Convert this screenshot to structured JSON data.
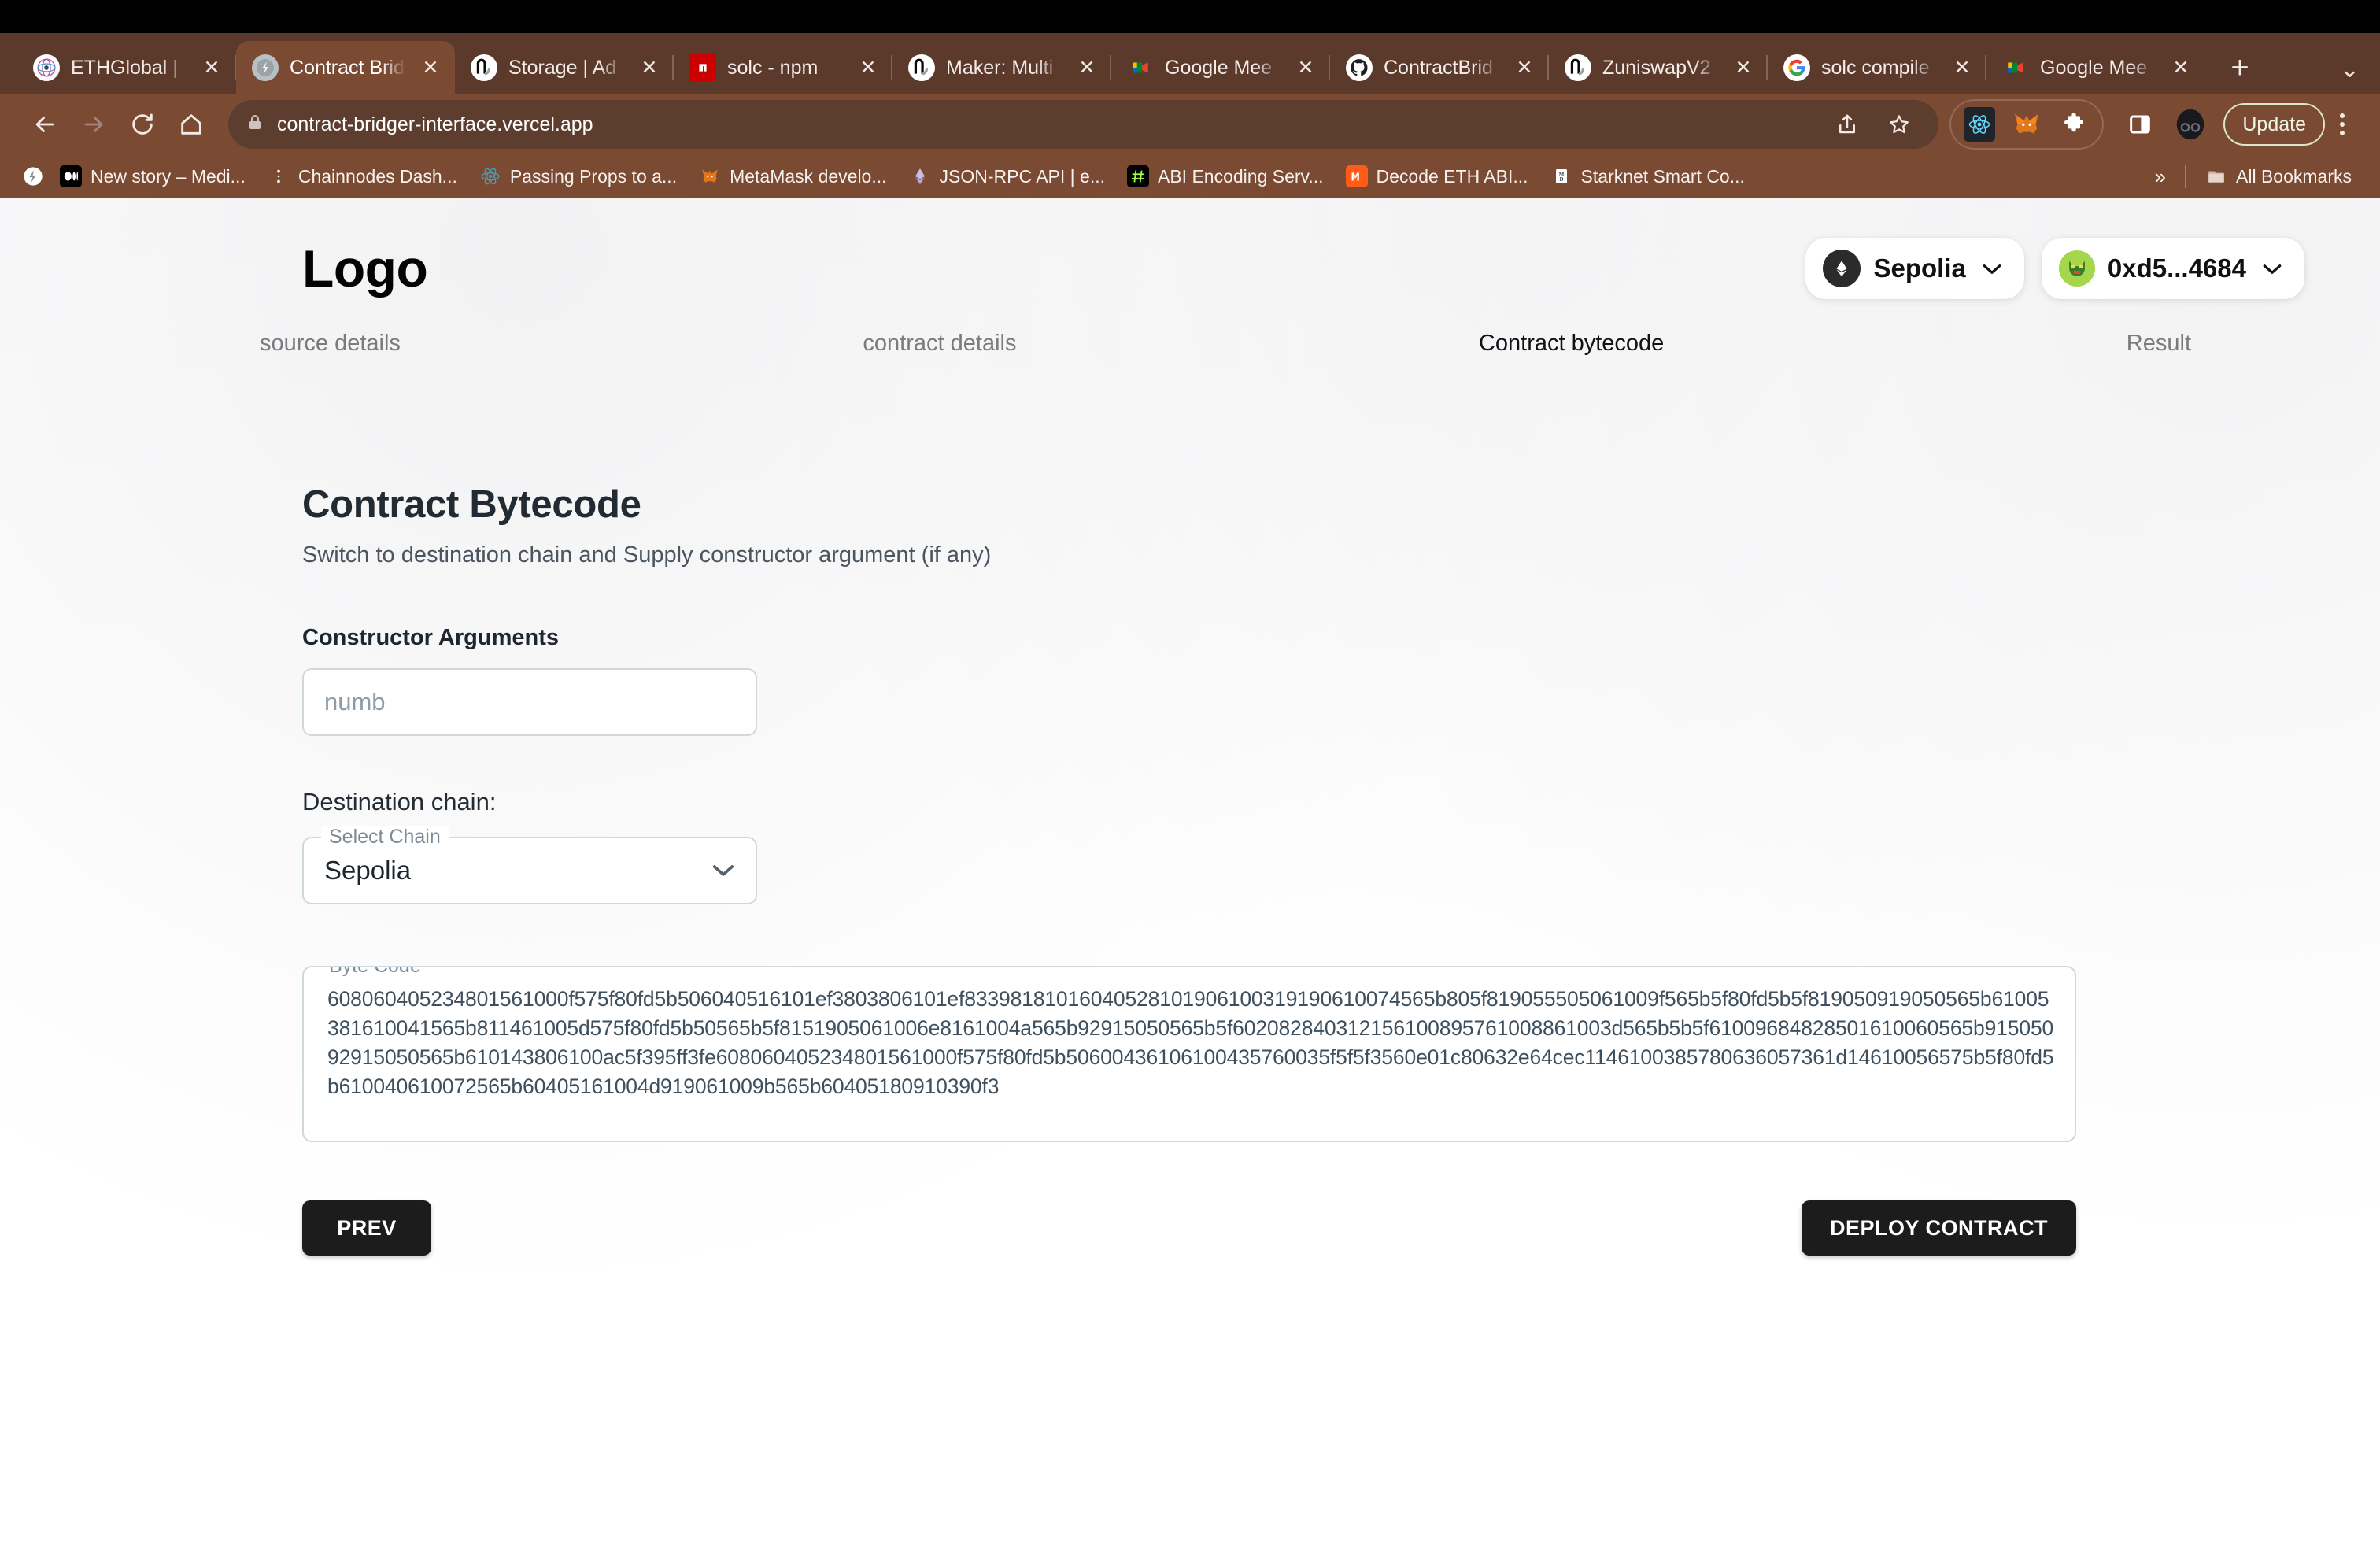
{
  "browser": {
    "tabs": [
      {
        "title": "ETHGlobal | ",
        "icon": "ethglobal-icon",
        "active": false
      },
      {
        "title": "Contract Brid",
        "icon": "contract-bridger-icon",
        "active": true
      },
      {
        "title": "Storage | Ad",
        "icon": "remix-icon",
        "active": false
      },
      {
        "title": "solc - npm",
        "icon": "npm-icon",
        "active": false
      },
      {
        "title": "Maker: Multi",
        "icon": "remix-icon",
        "active": false
      },
      {
        "title": "Google Mee",
        "icon": "google-meet-icon",
        "active": false
      },
      {
        "title": "ContractBrid",
        "icon": "github-icon",
        "active": false
      },
      {
        "title": "ZuniswapV2",
        "icon": "remix-icon",
        "active": false
      },
      {
        "title": "solc compile",
        "icon": "google-icon",
        "active": false
      },
      {
        "title": "Google Mee",
        "icon": "google-meet-icon",
        "active": false
      }
    ],
    "new_tab_label": "+",
    "tab_overflow_label": "⌄",
    "nav": {
      "back_label": "←",
      "forward_label": "→",
      "reload_label": "↻",
      "home_label": "⌂"
    },
    "omnibox": {
      "url": "contract-bridger-interface.vercel.app",
      "lock_icon": "lock-icon",
      "share_icon": "share-icon",
      "bookmark_icon": "star-icon"
    },
    "extensions": [
      {
        "name": "react-devtools-icon"
      },
      {
        "name": "metamask-icon"
      },
      {
        "name": "puzzle-icon"
      }
    ],
    "side_panel_icon": "side-panel-icon",
    "profile_icon": "profile-avatar-icon",
    "update_label": "Update",
    "menu_icon": "kebab-menu-icon",
    "bookmarks": [
      {
        "label": "New story – Medi...",
        "icon": "medium-icon"
      },
      {
        "label": "Chainnodes Dash...",
        "icon": "chainnodes-icon"
      },
      {
        "label": "Passing Props to a...",
        "icon": "react-icon"
      },
      {
        "label": "MetaMask develo...",
        "icon": "metamask-icon"
      },
      {
        "label": "JSON-RPC API | e...",
        "icon": "ethereum-icon"
      },
      {
        "label": "ABI Encoding Serv...",
        "icon": "hash-icon"
      },
      {
        "label": "Decode ETH ABI...",
        "icon": "decode-icon"
      },
      {
        "label": "Starknet Smart Co...",
        "icon": "markdown-icon"
      }
    ],
    "bookmarks_overflow_label": "»",
    "all_bookmarks_label": "All Bookmarks",
    "all_bookmarks_icon": "folder-icon"
  },
  "app": {
    "logo": "Logo",
    "network": {
      "label": "Sepolia",
      "icon": "ethereum-diamond-icon",
      "chevron": "⌄"
    },
    "wallet": {
      "address": "0xd5...4684",
      "avatar_icon": "wallet-avatar-icon",
      "chevron": "⌄"
    },
    "steps": [
      {
        "label": "source details",
        "current": false
      },
      {
        "label": "contract details",
        "current": false
      },
      {
        "label": "Contract bytecode",
        "current": true
      },
      {
        "label": "Result",
        "current": false
      }
    ],
    "heading": "Contract Bytecode",
    "subheading": "Switch to destination chain and Supply constructor argument (if any)",
    "constructor": {
      "label": "Constructor Arguments",
      "placeholder": "numb",
      "value": ""
    },
    "destination": {
      "label": "Destination chain:",
      "legend": "Select Chain",
      "value": "Sepolia",
      "chevron": "⌄",
      "options": [
        "Sepolia"
      ]
    },
    "bytecode": {
      "legend": "Byte Code",
      "value": "60806040523480156100​0f575f80fd5b506040516101ef3803806101ef833981810160405281019061003191906100745​65b805f819055505061009f565b5f80fd5b5f819050919050565b61005381610041565b811461005d575f80fd5b50565b5f8151905061006e8161004a565b92915050565b5f6020828403121561008957610088​61003d565b5b5f61009684828501610060565b91505092915050565b610143806100ac5f395ff3fe608060405234801561000f575f80fd5b5060​0436106100435760035f5f5f3560e01c80632e64cec1146100385780636057361d1461005657​5b5f80fd5b610040610072565b60405161004d919061009b565b60405180910390f3"
    },
    "buttons": {
      "prev": "PREV",
      "deploy": "DEPLOY CONTRACT"
    }
  }
}
